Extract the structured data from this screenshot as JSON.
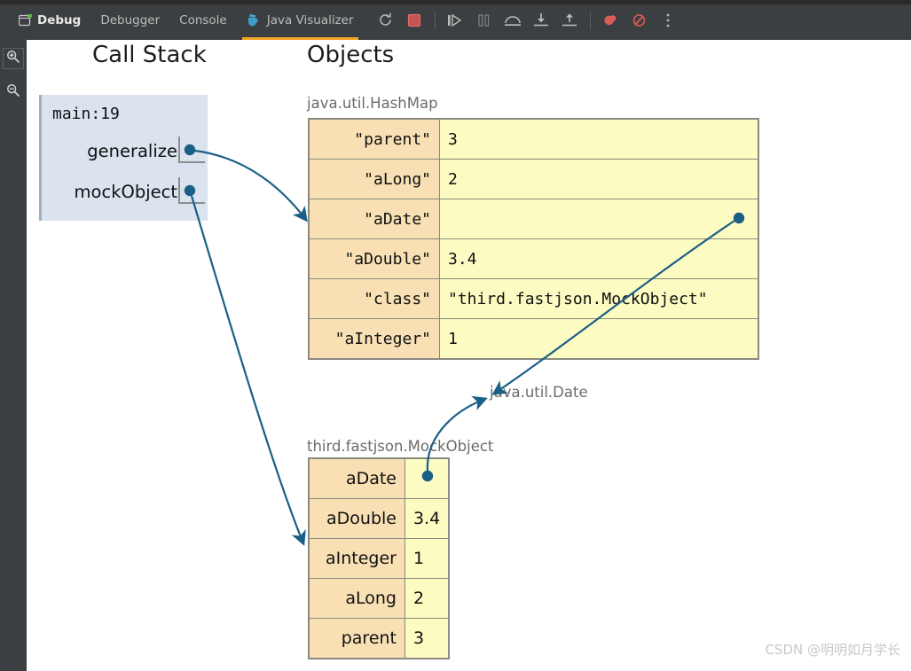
{
  "toolbar": {
    "debug_label": "Debug",
    "tabs": [
      {
        "label": "Debugger",
        "icon": "",
        "active": false
      },
      {
        "label": "Console",
        "icon": "",
        "active": false
      },
      {
        "label": "Java Visualizer",
        "icon": "coffee-cup-icon",
        "active": true
      }
    ],
    "icons": [
      "rerun-icon",
      "stop-icon",
      "resume-icon",
      "pause-icon",
      "step-over-icon",
      "step-into-icon",
      "step-out-icon",
      "mute-breakpoints-icon",
      "view-breakpoints-icon",
      "more-options-icon"
    ]
  },
  "gutter": {
    "zoom_in": "zoom-in-icon",
    "zoom_out": "zoom-out-icon"
  },
  "headings": {
    "call_stack": "Call Stack",
    "objects": "Objects"
  },
  "call_stack": {
    "frame_title": "main:19",
    "variables": [
      {
        "name": "generalize"
      },
      {
        "name": "mockObject"
      }
    ]
  },
  "objects": [
    {
      "label": "java.util.HashMap",
      "rows": [
        {
          "key": "\"parent\"",
          "value": "3"
        },
        {
          "key": "\"aLong\"",
          "value": "2"
        },
        {
          "key": "\"aDate\"",
          "value": ""
        },
        {
          "key": "\"aDouble\"",
          "value": "3.4"
        },
        {
          "key": "\"class\"",
          "value": "\"third.fastjson.MockObject\""
        },
        {
          "key": "\"aInteger\"",
          "value": "1"
        }
      ]
    },
    {
      "label": "java.util.Date",
      "rows": []
    },
    {
      "label": "third.fastjson.MockObject",
      "rows": [
        {
          "key": "aDate",
          "value": ""
        },
        {
          "key": "aDouble",
          "value": "3.4"
        },
        {
          "key": "aInteger",
          "value": "1"
        },
        {
          "key": "aLong",
          "value": "2"
        },
        {
          "key": "parent",
          "value": "3"
        }
      ]
    }
  ],
  "colors": {
    "toolbar_bg": "#3c3f41",
    "active_tab_underline": "#f5a623",
    "frame_bg": "#dbe3ef",
    "key_cell": "#f8e0b4",
    "value_cell": "#fbfbc2",
    "arrow": "#1b5f86"
  },
  "watermark": "CSDN @明明如月学长"
}
